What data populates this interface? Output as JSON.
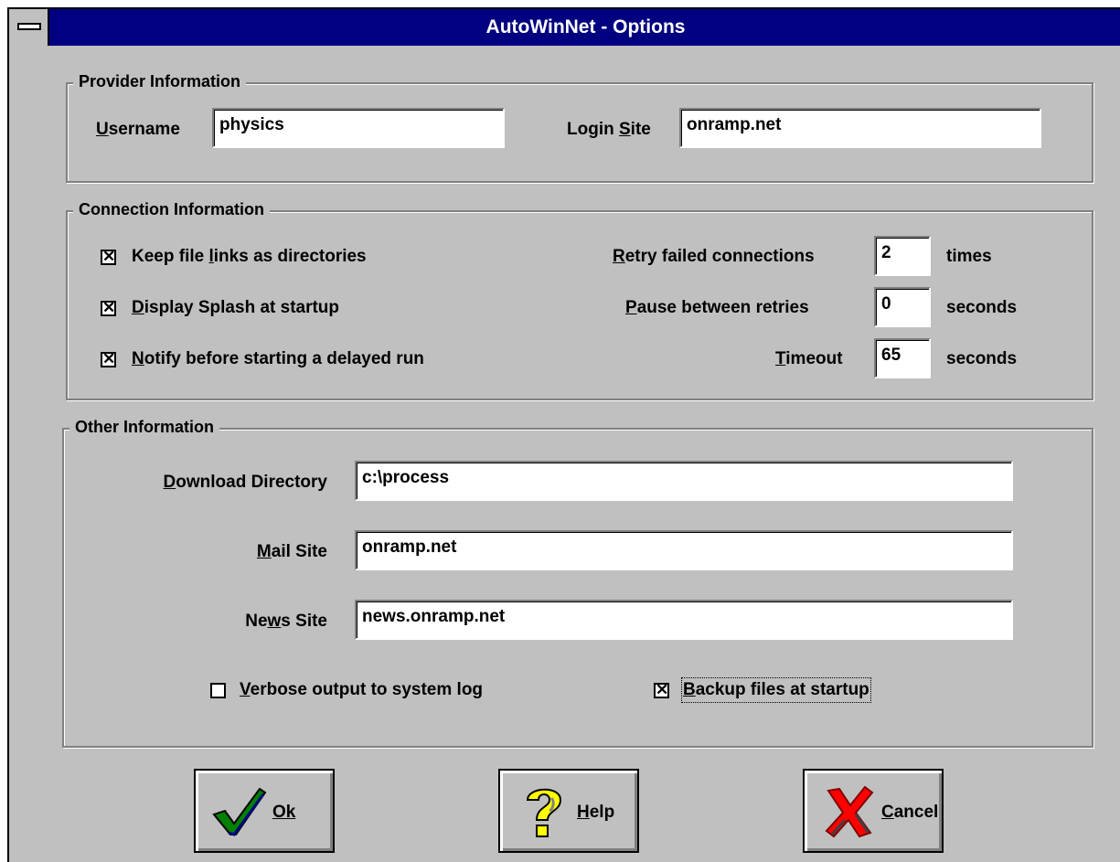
{
  "window": {
    "title": "AutoWinNet - Options"
  },
  "provider": {
    "legend": "Provider Information",
    "username_label": "Username",
    "username_value": "physics",
    "login_site_label": "Login Site",
    "login_site_value": "onramp.net"
  },
  "connection": {
    "legend": "Connection Information",
    "checkboxes": [
      {
        "label": "Keep file links as directories",
        "checked": true
      },
      {
        "label": "Display Splash at startup",
        "checked": true
      },
      {
        "label": "Notify before starting a delayed run",
        "checked": true
      }
    ],
    "retry_label": "Retry failed connections",
    "retry_value": "2",
    "retry_unit": "times",
    "pause_label": "Pause between retries",
    "pause_value": "0",
    "pause_unit": "seconds",
    "timeout_label": "Timeout",
    "timeout_value": "65",
    "timeout_unit": "seconds"
  },
  "other": {
    "legend": "Other Information",
    "download_label": "Download Directory",
    "download_value": "c:\\process",
    "mail_label": "Mail Site",
    "mail_value": "onramp.net",
    "news_label": "News Site",
    "news_value": "news.onramp.net",
    "verbose_label": "Verbose output to system log",
    "verbose_checked": false,
    "backup_label": "Backup files at startup",
    "backup_checked": true
  },
  "buttons": {
    "ok": {
      "label": "Ok",
      "icon": "checkmark-icon"
    },
    "help": {
      "label": "Help",
      "icon": "question-mark-icon"
    },
    "cancel": {
      "label": "Cancel",
      "icon": "red-x-icon"
    }
  },
  "colors": {
    "titlebar": "#000080",
    "face": "#c0c0c0"
  }
}
